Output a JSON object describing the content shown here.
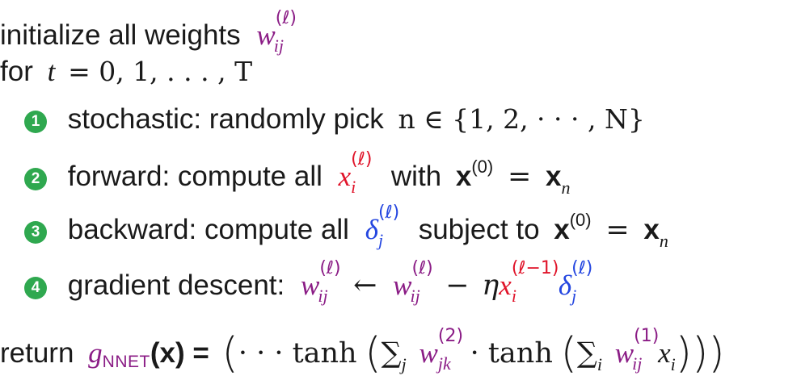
{
  "line1": {
    "text": "initialize all weights",
    "weight": "w",
    "weight_sub": "ij",
    "weight_sup": "(ℓ)"
  },
  "line2": {
    "text": "for",
    "var": "t",
    "range": "= 0, 1, . . . , T"
  },
  "steps": [
    {
      "num": "1",
      "label": "stochastic: randomly pick",
      "expr": "n ∈ {1, 2, · · · , N}"
    },
    {
      "num": "2",
      "label": "forward: compute all",
      "mid": "with",
      "cond": "x",
      "cond_sup": "(0)",
      "eq": "=",
      "rhs": "x",
      "rhs_sub": "n"
    },
    {
      "num": "3",
      "label": "backward: compute all",
      "mid": "subject to",
      "cond": "x",
      "cond_sup": "(0)",
      "eq": "=",
      "rhs": "x",
      "rhs_sub": "n"
    },
    {
      "num": "4",
      "label": "gradient descent:",
      "arrow": "←",
      "minus": "−",
      "eta": "η"
    }
  ],
  "return_line": {
    "text": "return",
    "g": "g",
    "g_sub": "NNET",
    "arg": "(x) =",
    "dots": "· · · tanh",
    "sum": "∑",
    "sum1_sub": "j",
    "w2_sup": "(2)",
    "w2_sub": "jk",
    "dot": "· tanh",
    "sum2_sub": "i",
    "w1_sup": "(1)",
    "w1_sub": "ij",
    "xi": "x",
    "xi_sub": "i"
  },
  "symbols": {
    "w": "w",
    "x": "x",
    "delta": "δ",
    "l": "(ℓ)",
    "lm1": "(ℓ−1)",
    "i": "i",
    "j": "j",
    "ij": "ij"
  },
  "colors": {
    "purple": "#8b1d86",
    "red": "#e0142a",
    "blue": "#2446e0",
    "bullet": "#2fa84f"
  }
}
